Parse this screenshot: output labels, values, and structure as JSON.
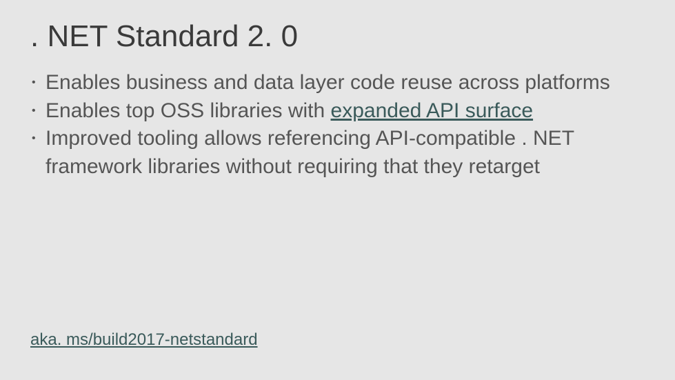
{
  "title": ". NET Standard 2. 0",
  "bullets": [
    {
      "pre": "Enables business and data layer code reuse across platforms",
      "link": "",
      "post": ""
    },
    {
      "pre": "Enables top OSS libraries with ",
      "link": "expanded API surface",
      "post": ""
    },
    {
      "pre": "Improved tooling allows referencing API-compatible . NET framework libraries without requiring that they retarget",
      "link": "",
      "post": ""
    }
  ],
  "footer_link": "aka. ms/build2017-netstandard"
}
